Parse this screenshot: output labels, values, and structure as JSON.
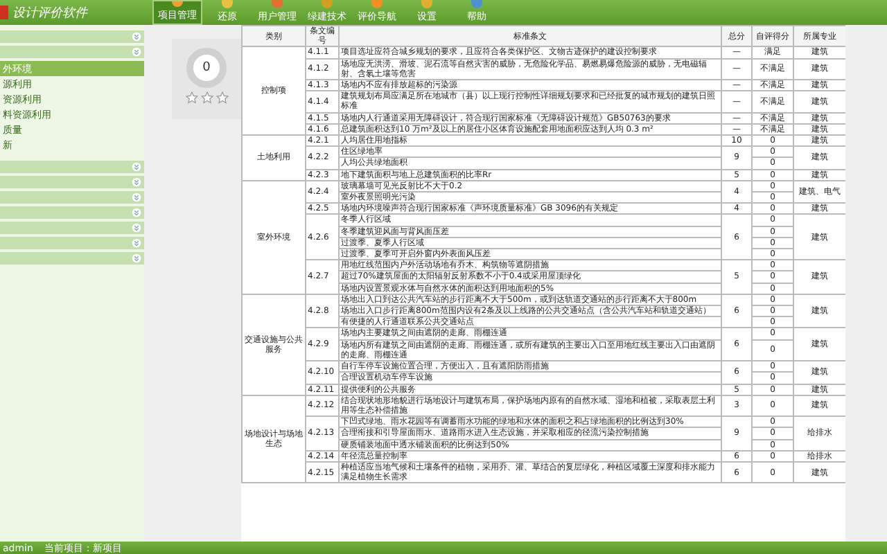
{
  "app": {
    "title": "设计评价软件"
  },
  "nav": [
    {
      "label": "项目管理",
      "selected": true
    },
    {
      "label": "还原",
      "selected": false
    },
    {
      "label": "用户管理",
      "selected": false
    },
    {
      "label": "绿建技术",
      "selected": false
    },
    {
      "label": "评价导航",
      "selected": false
    },
    {
      "label": "设置",
      "selected": false
    },
    {
      "label": "帮助",
      "selected": false
    }
  ],
  "sidebar": {
    "items": [
      {
        "label": "外环境",
        "selected": true
      },
      {
        "label": "源利用",
        "selected": false
      },
      {
        "label": "资源利用",
        "selected": false
      },
      {
        "label": "料资源利用",
        "selected": false
      },
      {
        "label": "质量",
        "selected": false
      },
      {
        "label": "新",
        "selected": false
      }
    ]
  },
  "score_panel": {
    "score": "0",
    "stars": 0
  },
  "table": {
    "columns": [
      "类别",
      "条文编号",
      "标准条文",
      "总分",
      "自评得分",
      "所属专业"
    ],
    "groups": [
      {
        "category": "控制项",
        "items": [
          {
            "code": "4.1.1",
            "total": "—",
            "major": "建筑",
            "lines": [
              {
                "text": "项目选址应符合城乡规划的要求，且应符合各类保护区、文物古迹保护的建设控制要求",
                "score": "满足"
              }
            ]
          },
          {
            "code": "4.1.2",
            "total": "—",
            "major": "建筑",
            "lines": [
              {
                "text": "场地应无洪涝、滑坡、泥石流等自然灾害的威胁，无危险化学品、易燃易爆危险源的威胁，无电磁辐射、含氡土壤等危害",
                "score": "不满足"
              }
            ]
          },
          {
            "code": "4.1.3",
            "total": "—",
            "major": "建筑",
            "lines": [
              {
                "text": "场地内不应有排放超标的污染源",
                "score": "不满足"
              }
            ]
          },
          {
            "code": "4.1.4",
            "total": "—",
            "major": "建筑",
            "lines": [
              {
                "text": "建筑规划布局应满足所在地城市（县）以上现行控制性详细规划要求和已经批复的城市规划的建筑日照标准",
                "score": "不满足"
              }
            ]
          },
          {
            "code": "4.1.5",
            "total": "—",
            "major": "建筑",
            "lines": [
              {
                "text": "场地内人行通道采用无障碍设计，符合现行国家标准《无障碍设计规范》GB50763的要求",
                "score": "不满足"
              }
            ]
          },
          {
            "code": "4.1.6",
            "total": "—",
            "major": "建筑",
            "lines": [
              {
                "text": "总建筑面积达到10 万m²及以上的居住小区体育设施配套用地面积应达到人均 0.3 m²",
                "score": "不满足"
              }
            ]
          }
        ]
      },
      {
        "category": "土地利用",
        "items": [
          {
            "code": "4.2.1",
            "total": "10",
            "major": "建筑",
            "lines": [
              {
                "text": "人均居住用地指标",
                "score": "0"
              }
            ]
          },
          {
            "code": "4.2.2",
            "total": "9",
            "major": "建筑",
            "lines": [
              {
                "text": "住区绿地率",
                "score": "0"
              },
              {
                "text": "人均公共绿地面积",
                "score": "0"
              }
            ]
          },
          {
            "code": "4.2.3",
            "total": "5",
            "major": "建筑",
            "lines": [
              {
                "text": "地下建筑面积与地上总建筑面积的比率Rr",
                "score": "0"
              }
            ]
          }
        ]
      },
      {
        "category": "室外环境",
        "items": [
          {
            "code": "4.2.4",
            "total": "4",
            "major": "建筑、电气",
            "lines": [
              {
                "text": "玻璃幕墙可见光反射比不大于0.2",
                "score": "0"
              },
              {
                "text": "室外夜景照明光污染",
                "score": "0"
              }
            ]
          },
          {
            "code": "4.2.5",
            "total": "4",
            "major": "建筑",
            "lines": [
              {
                "text": "场地内环境噪声符合现行国家标准《声环境质量标准》GB 3096的有关规定",
                "score": "0"
              }
            ]
          },
          {
            "code": "4.2.6",
            "total": "6",
            "major": "建筑",
            "lines": [
              {
                "text": "冬季人行区域",
                "score": "0"
              },
              {
                "text": "冬季建筑迎风面与背风面压差",
                "score": "0"
              },
              {
                "text": "过渡季、夏季人行区域",
                "score": "0"
              },
              {
                "text": "过渡季、夏季可开启外窗内外表面风压差",
                "score": "0"
              }
            ]
          },
          {
            "code": "4.2.7",
            "total": "5",
            "major": "建筑",
            "lines": [
              {
                "text": "用地红线范围内户外活动场地有乔木、构筑物等遮阴措施",
                "score": "0"
              },
              {
                "text": "超过70%建筑屋面的太阳辐射反射系数不小于0.4或采用屋顶绿化",
                "score": "0"
              },
              {
                "text": "场地内设置景观水体与自然水体的面积达到用地面积的5%",
                "score": "0"
              }
            ]
          }
        ]
      },
      {
        "category": "交通设施与公共服务",
        "items": [
          {
            "code": "4.2.8",
            "total": "6",
            "major": "建筑",
            "lines": [
              {
                "text": "场地出入口到达公共汽车站的步行距离不大于500m，或到达轨道交通站的步行距离不大于800m",
                "score": "0"
              },
              {
                "text": "场地出入口步行距离800m范围内设有2条及以上线路的公共交通站点（含公共汽车站和轨道交通站）",
                "score": "0"
              },
              {
                "text": "有便捷的人行通道联系公共交通站点",
                "score": "0"
              }
            ]
          },
          {
            "code": "4.2.9",
            "total": "6",
            "major": "建筑",
            "lines": [
              {
                "text": "场地内主要建筑之间由遮阴的走廊、雨棚连通",
                "score": "0"
              },
              {
                "text": "场地内所有建筑之间由遮阴的走廊、雨棚连通，或所有建筑的主要出入口至用地红线主要出入口由遮阴的走廊、雨棚连通",
                "score": "0"
              }
            ]
          },
          {
            "code": "4.2.10",
            "total": "6",
            "major": "建筑",
            "lines": [
              {
                "text": "自行车停车设施位置合理，方便出入，且有遮阳防雨措施",
                "score": "0"
              },
              {
                "text": "合理设置机动车停车设施",
                "score": "0"
              }
            ]
          },
          {
            "code": "4.2.11",
            "total": "5",
            "major": "建筑",
            "lines": [
              {
                "text": "提供便利的公共服务",
                "score": "0"
              }
            ]
          }
        ]
      },
      {
        "category": "场地设计与场地生态",
        "items": [
          {
            "code": "4.2.12",
            "total": "3",
            "major": "建筑",
            "lines": [
              {
                "text": "结合现状地形地貌进行场地设计与建筑布局，保护场地内原有的自然水域、湿地和植被，采取表层土利用等生态补偿措施",
                "score": "0"
              }
            ]
          },
          {
            "code": "4.2.13",
            "total": "9",
            "major": "给排水",
            "lines": [
              {
                "text": "下凹式绿地、雨水花园等有调蓄雨水功能的绿地和水体的面积之和占绿地面积的比例达到30%",
                "score": "0"
              },
              {
                "text": "合理衔接和引导屋面雨水、道路雨水进入生态设施，并采取相应的径流污染控制措施",
                "score": "0"
              },
              {
                "text": "硬质铺装地面中透水铺装面积的比例达到50%",
                "score": "0"
              }
            ]
          },
          {
            "code": "4.2.14",
            "total": "6",
            "major": "给排水",
            "lines": [
              {
                "text": "年径流总量控制率",
                "score": "0"
              }
            ]
          },
          {
            "code": "4.2.15",
            "total": "6",
            "major": "建筑",
            "lines": [
              {
                "text": "种植适应当地气候和土壤条件的植物，采用乔、灌、草结合的复层绿化，种植区域覆土深度和排水能力满足植物生长需求",
                "score": "0"
              }
            ]
          }
        ]
      }
    ]
  },
  "status_bar": {
    "user": "admin",
    "project": "当前项目：新项目"
  }
}
